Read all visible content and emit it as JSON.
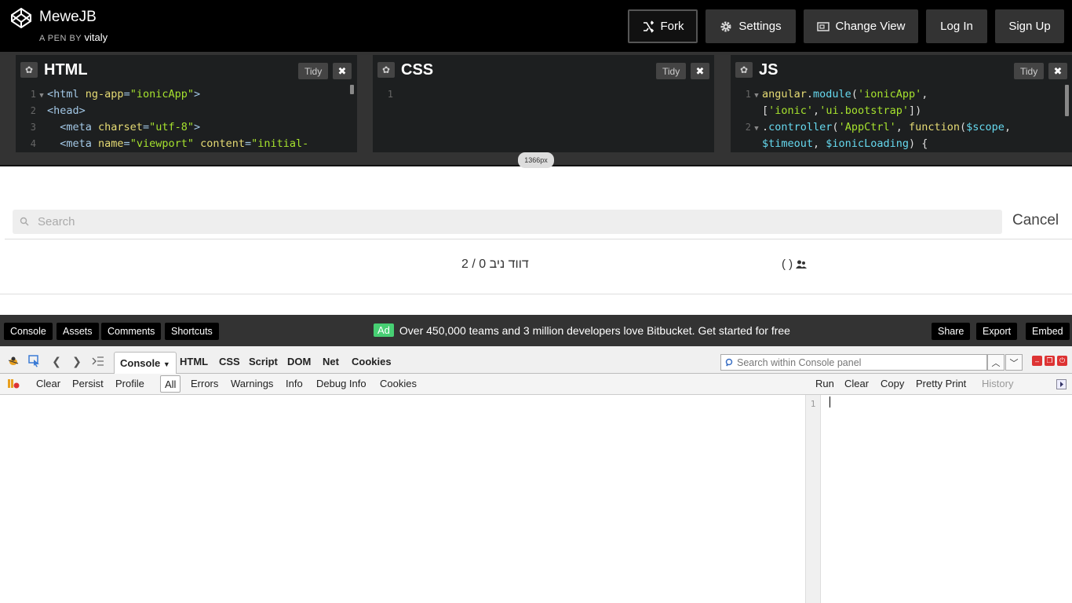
{
  "header": {
    "pen_title": "MeweJB",
    "pen_by_label": "A PEN BY",
    "author": "vitaly",
    "buttons": {
      "fork": "Fork",
      "settings": "Settings",
      "change_view": "Change View",
      "login": "Log In",
      "signup": "Sign Up"
    }
  },
  "editors": {
    "html": {
      "title": "HTML",
      "tidy": "Tidy",
      "lines": [
        {
          "n": "1",
          "parts": [
            [
              "t-tag",
              "<html "
            ],
            [
              "t-attr",
              "ng-app"
            ],
            [
              "t-tag",
              "="
            ],
            [
              "t-str",
              "\"ionicApp\""
            ],
            [
              "t-tag",
              ">"
            ]
          ]
        },
        {
          "n": "2",
          "parts": [
            [
              "t-tag",
              "<head>"
            ]
          ]
        },
        {
          "n": "3",
          "parts": [
            [
              "t-tag",
              "  <meta "
            ],
            [
              "t-attr",
              "charset"
            ],
            [
              "t-tag",
              "="
            ],
            [
              "t-str",
              "\"utf-8\""
            ],
            [
              "t-tag",
              ">"
            ]
          ]
        },
        {
          "n": "4",
          "parts": [
            [
              "t-tag",
              "  <meta "
            ],
            [
              "t-attr",
              "name"
            ],
            [
              "t-tag",
              "="
            ],
            [
              "t-str",
              "\"viewport\""
            ],
            [
              "t-tag",
              " "
            ],
            [
              "t-attr",
              "content"
            ],
            [
              "t-tag",
              "="
            ],
            [
              "t-str",
              "\"initial-"
            ]
          ]
        }
      ]
    },
    "css": {
      "title": "CSS",
      "tidy": "Tidy",
      "line_no": "1"
    },
    "js": {
      "title": "JS",
      "tidy": "Tidy",
      "lines": [
        {
          "n": "1",
          "parts": [
            [
              "t-fn",
              "angular"
            ],
            [
              "t-plain",
              "."
            ],
            [
              "t-var",
              "module"
            ],
            [
              "t-plain",
              "("
            ],
            [
              "t-str",
              "'ionicApp'"
            ],
            [
              "t-plain",
              ","
            ]
          ]
        },
        {
          "n": "",
          "parts": [
            [
              "t-plain",
              "["
            ],
            [
              "t-str",
              "'ionic'"
            ],
            [
              "t-plain",
              ","
            ],
            [
              "t-str",
              "'ui.bootstrap'"
            ],
            [
              "t-plain",
              "])"
            ]
          ]
        },
        {
          "n": "2",
          "parts": [
            [
              "t-plain",
              "."
            ],
            [
              "t-var",
              "controller"
            ],
            [
              "t-plain",
              "("
            ],
            [
              "t-str",
              "'AppCtrl'"
            ],
            [
              "t-plain",
              ", "
            ],
            [
              "t-fn",
              "function"
            ],
            [
              "t-plain",
              "("
            ],
            [
              "t-var",
              "$scope"
            ],
            [
              "t-plain",
              ","
            ]
          ]
        },
        {
          "n": "",
          "parts": [
            [
              "t-var",
              "$timeout"
            ],
            [
              "t-plain",
              ", "
            ],
            [
              "t-var",
              "$ionicLoading"
            ],
            [
              "t-plain",
              ") {"
            ]
          ]
        }
      ]
    },
    "width_badge": "1366px"
  },
  "preview": {
    "search_placeholder": "Search",
    "cancel": "Cancel",
    "item_name": "דווד ניב 0 / 2",
    "item_group": "( )"
  },
  "bottombar": {
    "console": "Console",
    "assets": "Assets",
    "comments": "Comments",
    "shortcuts": "Shortcuts",
    "ad_badge": "Ad",
    "ad_text": "Over 450,000 teams and 3 million developers love Bitbucket. Get started for free",
    "share": "Share",
    "export": "Export",
    "embed": "Embed"
  },
  "firebug": {
    "tabs": [
      "Console",
      "HTML",
      "CSS",
      "Script",
      "DOM",
      "Net",
      "Cookies"
    ],
    "search_placeholder": "Search within Console panel",
    "tools_left": [
      "Clear",
      "Persist",
      "Profile"
    ],
    "filters": [
      "All",
      "Errors",
      "Warnings",
      "Info",
      "Debug Info",
      "Cookies"
    ],
    "tools_right": [
      "Run",
      "Clear",
      "Copy",
      "Pretty Print",
      "History"
    ],
    "cmd_line_no": "1"
  }
}
